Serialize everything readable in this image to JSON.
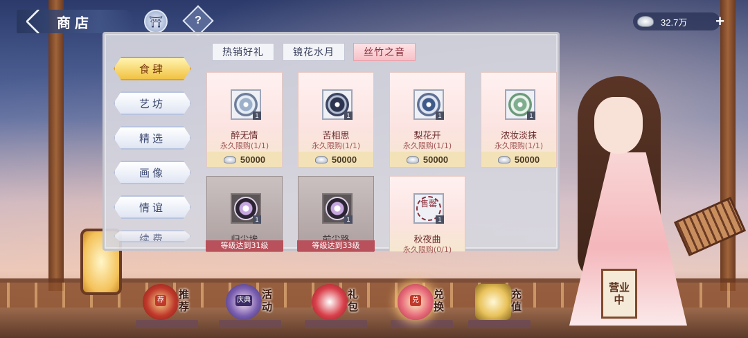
{
  "header": {
    "title": "商店",
    "tower_icon": "tower-icon",
    "help_label": "?",
    "currency": {
      "value": "32.7万",
      "icon": "silver-ingot-icon",
      "add_label": "+"
    }
  },
  "categories": [
    {
      "label": "食肆",
      "active": true
    },
    {
      "label": "艺坊",
      "active": false
    },
    {
      "label": "精选",
      "active": false
    },
    {
      "label": "画像",
      "active": false
    },
    {
      "label": "情谊",
      "active": false
    },
    {
      "label": "续费",
      "active": false
    }
  ],
  "tabs": [
    {
      "label": "热销好礼",
      "active": false
    },
    {
      "label": "镜花水月",
      "active": false
    },
    {
      "label": "丝竹之音",
      "active": true
    }
  ],
  "items": [
    {
      "name": "醉无情",
      "limit": "永久限购(1/1)",
      "price": "50000",
      "count": "1",
      "locked": false,
      "icon": "disc-icon"
    },
    {
      "name": "苦相思",
      "limit": "永久限购(1/1)",
      "price": "50000",
      "count": "1",
      "locked": false,
      "icon": "disc-icon"
    },
    {
      "name": "梨花开",
      "limit": "永久限购(1/1)",
      "price": "50000",
      "count": "1",
      "locked": false,
      "icon": "disc-icon"
    },
    {
      "name": "浓妆淡抹",
      "limit": "永久限购(1/1)",
      "price": "50000",
      "count": "1",
      "locked": false,
      "icon": "disc-icon"
    },
    {
      "name": "归尘埃",
      "requirement": "等级达到31级",
      "count": "1",
      "locked": true,
      "icon": "dark-orb-icon"
    },
    {
      "name": "前尘路",
      "requirement": "等级达到33级",
      "count": "1",
      "locked": true,
      "icon": "dark-orb-icon"
    },
    {
      "name": "秋夜曲",
      "limit": "永久限购(0/1)",
      "count": "1",
      "locked": false,
      "seal": "售罄",
      "icon": "sold-out-seal-icon"
    }
  ],
  "bottom_nav": [
    {
      "label": "推荐",
      "seal": "荐"
    },
    {
      "label": "活动",
      "seal": "庆典"
    },
    {
      "label": "礼包",
      "seal": ""
    },
    {
      "label": "兑换",
      "seal": "兑"
    },
    {
      "label": "充值",
      "seal": ""
    }
  ],
  "sign": {
    "line1": "营业",
    "line2": "中"
  },
  "colors": {
    "accent_gold": "#f2c243",
    "active_tab_pink": "#f7c1c7",
    "price_bar": "#f3e2b8",
    "lock_red": "#b8515b"
  }
}
